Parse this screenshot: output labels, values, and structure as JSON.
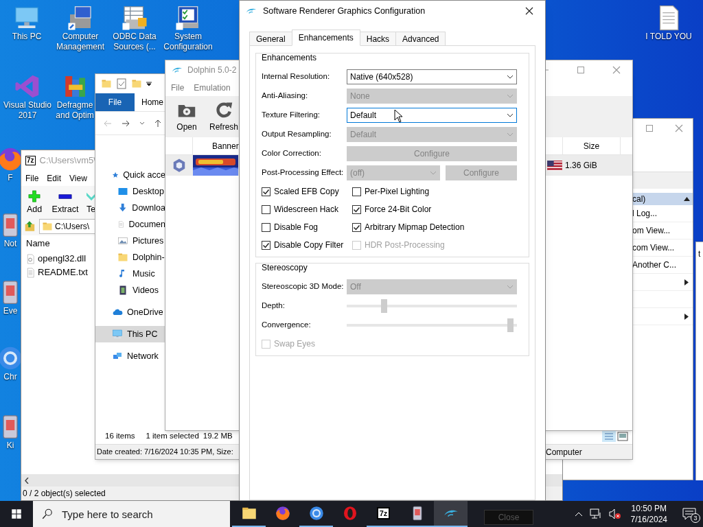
{
  "desktop_icons": [
    {
      "lines": [
        "This PC"
      ]
    },
    {
      "lines": [
        "Computer",
        "Management"
      ]
    },
    {
      "lines": [
        "ODBC Data",
        "Sources (..."
      ]
    },
    {
      "lines": [
        "System",
        "Configuration"
      ]
    },
    {
      "lines": [
        "Visual Studio",
        "2017"
      ]
    },
    {
      "lines": [
        "Defragme",
        "and Optim"
      ]
    },
    {
      "lines": [
        "F"
      ]
    },
    {
      "lines": [
        "Not"
      ]
    },
    {
      "lines": [
        "Eve"
      ]
    },
    {
      "lines": [
        "Chr"
      ]
    },
    {
      "lines": [
        "Ki"
      ]
    },
    {
      "lines": [
        "I TOLD YOU"
      ]
    }
  ],
  "back_window": {
    "fragment": "t"
  },
  "computer_management": {
    "header": "cal)",
    "items": [
      {
        "kind": "action",
        "label": "l Log..."
      },
      {
        "kind": "action",
        "label": "om View..."
      },
      {
        "kind": "action",
        "label": "com View..."
      },
      {
        "kind": "action",
        "label": "Another C..."
      },
      {
        "kind": "submenu"
      },
      {
        "kind": "empty"
      },
      {
        "kind": "submenu"
      }
    ]
  },
  "sevenzip": {
    "icon_text": "7z",
    "title": "C:\\Users\\vm5\\",
    "menu": [
      "File",
      "Edit",
      "View"
    ],
    "toolbar": [
      "Add",
      "Extract",
      "Te"
    ],
    "address": "C:\\Users\\",
    "column": "Name",
    "files": [
      "opengl32.dll",
      "README.txt"
    ],
    "status": "0 / 2 object(s) selected"
  },
  "explorer": {
    "tabs": [
      {
        "label": "File",
        "selected": true
      },
      {
        "label": "Home",
        "selected": false
      }
    ],
    "nav": [
      {
        "label": "Quick acce",
        "selected": false,
        "children": [
          {
            "label": "Desktop",
            "selected": false
          },
          {
            "label": "Downloa",
            "selected": false
          },
          {
            "label": "Documen",
            "selected": false
          },
          {
            "label": "Pictures",
            "selected": false
          },
          {
            "label": "Dolphin-",
            "selected": false
          },
          {
            "label": "Music",
            "selected": false
          },
          {
            "label": "Videos",
            "selected": false
          }
        ]
      },
      {
        "label": "OneDrive",
        "selected": false
      },
      {
        "label": "This PC",
        "selected": true
      },
      {
        "label": "Network",
        "selected": false
      }
    ],
    "status": {
      "count": "16 items",
      "selection": "1 item selected",
      "size": "19.2 MB"
    },
    "details": "Date created: 7/16/2024 10:35 PM, Size:",
    "details_right": "Computer"
  },
  "dolphin": {
    "title": "Dolphin 5.0-2",
    "menu": [
      "File",
      "Emulation"
    ],
    "toolbar": [
      "Open",
      "Refresh"
    ],
    "columns": [
      "Banner",
      "Size"
    ],
    "games": [
      {
        "size": "1.36 GiB",
        "selected": true
      }
    ]
  },
  "dialog": {
    "title": "Software Renderer Graphics Configuration",
    "tabs": [
      {
        "label": "General",
        "selected": false
      },
      {
        "label": "Enhancements",
        "selected": true
      },
      {
        "label": "Hacks",
        "selected": false
      },
      {
        "label": "Advanced",
        "selected": false
      }
    ],
    "enhancements": {
      "title": "Enhancements",
      "rows": [
        {
          "kind": "dropdown",
          "label": "Internal Resolution:",
          "dropdown": {
            "value": "Native (640x528)",
            "disabled": false
          }
        },
        {
          "kind": "dropdown",
          "label": "Anti-Aliasing:",
          "dropdown": {
            "value": "None",
            "disabled": true
          }
        },
        {
          "kind": "dropdown",
          "label": "Texture Filtering:",
          "dropdown": {
            "value": "Default",
            "disabled": false,
            "focused": true
          }
        },
        {
          "kind": "dropdown",
          "label": "Output Resampling:",
          "dropdown": {
            "value": "Default",
            "disabled": true
          }
        },
        {
          "kind": "button",
          "label": "Color Correction:",
          "button": {
            "label": "Configure",
            "disabled": true
          }
        },
        {
          "kind": "dropdown_button",
          "label": "Post-Processing Effect:",
          "dropdown": {
            "value": "(off)",
            "disabled": true
          },
          "button": {
            "label": "Configure",
            "disabled": true
          }
        }
      ],
      "checkboxes": [
        {
          "label": "Scaled EFB Copy",
          "checked": true,
          "disabled": false
        },
        {
          "label": "Per-Pixel Lighting",
          "checked": false,
          "disabled": false
        },
        {
          "label": "Widescreen Hack",
          "checked": false,
          "disabled": false
        },
        {
          "label": "Force 24-Bit Color",
          "checked": true,
          "disabled": false
        },
        {
          "label": "Disable Fog",
          "checked": false,
          "disabled": false
        },
        {
          "label": "Arbitrary Mipmap Detection",
          "checked": true,
          "disabled": false
        },
        {
          "label": "Disable Copy Filter",
          "checked": true,
          "disabled": false
        },
        {
          "label": "HDR Post-Processing",
          "checked": false,
          "disabled": true
        }
      ]
    },
    "stereoscopy": {
      "title": "Stereoscopy",
      "rows": [
        {
          "kind": "dropdown",
          "label": "Stereoscopic 3D Mode:",
          "dropdown": {
            "value": "Off",
            "disabled": true
          }
        },
        {
          "kind": "slider",
          "label": "Depth:",
          "level": 0.21,
          "disabled": true
        },
        {
          "kind": "slider",
          "label": "Convergence:",
          "level": 0.98,
          "disabled": true
        }
      ],
      "checkboxes": [
        {
          "label": "Swap Eyes",
          "checked": false,
          "disabled": true
        }
      ]
    }
  },
  "taskbar": {
    "search_placeholder": "Type here to search",
    "apps": [
      {
        "running": true,
        "active": false
      },
      {
        "running": false,
        "active": false
      },
      {
        "running": true,
        "active": false
      },
      {
        "running": false,
        "active": false
      },
      {
        "label": "7z",
        "running": true,
        "active": false
      },
      {
        "running": true,
        "active": false
      },
      {
        "running": true,
        "active": true
      }
    ],
    "ghost_button": "Close",
    "volume_muted": true,
    "time": "10:50 PM",
    "date": "7/16/2024",
    "notifications": "3"
  }
}
